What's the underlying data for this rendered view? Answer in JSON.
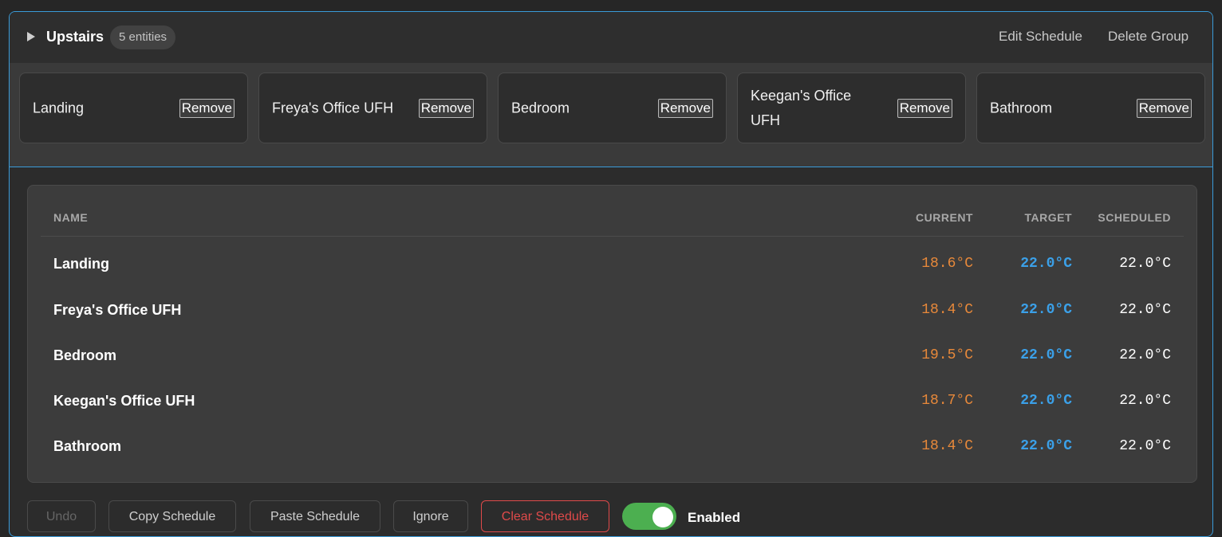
{
  "group": {
    "title": "Upstairs",
    "entity_count": "5 entities",
    "edit_label": "Edit Schedule",
    "delete_label": "Delete Group"
  },
  "chips": [
    {
      "label": "Landing",
      "remove": "Remove"
    },
    {
      "label": "Freya's Office UFH",
      "remove": "Remove"
    },
    {
      "label": "Bedroom",
      "remove": "Remove"
    },
    {
      "label": "Keegan's Office UFH",
      "remove": "Remove"
    },
    {
      "label": "Bathroom",
      "remove": "Remove"
    }
  ],
  "table": {
    "headers": {
      "name": "NAME",
      "current": "CURRENT",
      "target": "TARGET",
      "scheduled": "SCHEDULED"
    },
    "rows": [
      {
        "name": "Landing",
        "current": "18.6°C",
        "target": "22.0°C",
        "scheduled": "22.0°C"
      },
      {
        "name": "Freya's Office UFH",
        "current": "18.4°C",
        "target": "22.0°C",
        "scheduled": "22.0°C"
      },
      {
        "name": "Bedroom",
        "current": "19.5°C",
        "target": "22.0°C",
        "scheduled": "22.0°C"
      },
      {
        "name": "Keegan's Office UFH",
        "current": "18.7°C",
        "target": "22.0°C",
        "scheduled": "22.0°C"
      },
      {
        "name": "Bathroom",
        "current": "18.4°C",
        "target": "22.0°C",
        "scheduled": "22.0°C"
      }
    ]
  },
  "toolbar": {
    "undo": "Undo",
    "copy": "Copy Schedule",
    "paste": "Paste Schedule",
    "ignore": "Ignore",
    "clear": "Clear Schedule",
    "enabled_label": "Enabled",
    "enabled": true
  },
  "colors": {
    "accent_border": "#3a9bd9",
    "current_temp": "#e8893a",
    "target_temp": "#3ba0e8",
    "danger": "#e04a4a",
    "toggle_on": "#4caf50"
  }
}
